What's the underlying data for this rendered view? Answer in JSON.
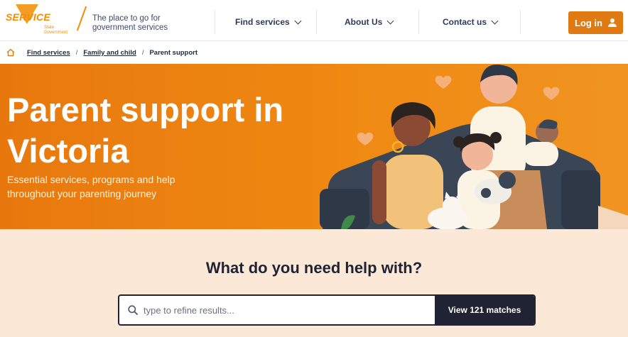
{
  "brand": {
    "logo_word": "SERVICE",
    "logo_sub_1": "State",
    "logo_sub_2": "Government",
    "tagline": "The place to go for government services",
    "accent": "#e07a12"
  },
  "nav": {
    "items": [
      {
        "label": "Find services"
      },
      {
        "label": "About Us"
      },
      {
        "label": "Contact us"
      }
    ],
    "login_label": "Log in"
  },
  "breadcrumb": {
    "items": [
      {
        "label": "Find services"
      },
      {
        "label": "Family and child"
      }
    ],
    "separator": "/",
    "current": "Parent support"
  },
  "hero": {
    "title": "Parent support in Victoria",
    "subtitle": "Essential services, programs and help throughout your parenting journey",
    "background": "#ef8912"
  },
  "search": {
    "heading": "What do you need help with?",
    "placeholder": "type to refine results...",
    "value": "",
    "button_label": "View 121 matches"
  },
  "icons": {
    "home": "home-icon",
    "chevron": "chevron-down-icon",
    "user": "user-icon",
    "search": "search-icon"
  }
}
